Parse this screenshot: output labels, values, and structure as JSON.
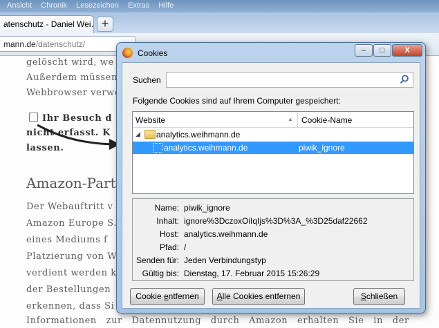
{
  "browser": {
    "menu": [
      "Ansicht",
      "Chronik",
      "Lesezeichen",
      "Extras",
      "Hilfe"
    ],
    "tab_title": "atenschutz - Daniel Wei…",
    "new_tab_label": "+",
    "url_domain": "mann.de",
    "url_path": "/datenschutz/"
  },
  "page": {
    "line1": "gelöscht wird, we",
    "line2": "Außerdem müssen",
    "line3": "Webbrowser verwe",
    "line4": "Ihr Besuch d",
    "line5": "nicht erfasst. K",
    "line6": "lassen.",
    "heading": "Amazon-Part",
    "para": [
      "Der Webauftritt v",
      "Amazon Europe S.",
      "eines Mediums f",
      "Platzierung von W",
      "verdient werden kö",
      "der Bestellungen",
      "erkennen, dass Si",
      "Informationen zur Datennutzung durch Amazon erhalten Sie in der"
    ]
  },
  "dialog": {
    "title": "Cookies",
    "search_label": "Suchen",
    "search_value": "",
    "info_text": "Folgende Cookies sind auf Ihrem Computer gespeichert:",
    "columns": [
      "Website",
      "Cookie-Name"
    ],
    "tree": {
      "group": "analytics.weihmann.de",
      "selected_site": "analytics.weihmann.de",
      "selected_name": "piwik_ignore"
    },
    "details": [
      {
        "label": "Name:",
        "value": "piwik_ignore"
      },
      {
        "label": "Inhalt:",
        "value": "ignore%3DczoxOiIqIjs%3D%3A_%3D25daf22662"
      },
      {
        "label": "Host:",
        "value": "analytics.weihmann.de"
      },
      {
        "label": "Pfad:",
        "value": "/"
      },
      {
        "label": "Senden für:",
        "value": "Jeden Verbindungstyp"
      },
      {
        "label": "Gültig bis:",
        "value": "Dienstag, 17. Februar 2015 15:26:29"
      }
    ],
    "buttons": {
      "remove_one_pre": "Cookie ",
      "remove_one_u": "e",
      "remove_one_post": "ntfernen",
      "remove_all_pre": "",
      "remove_all_u": "A",
      "remove_all_post": "lle Cookies entfernen",
      "close_pre": "",
      "close_u": "S",
      "close_post": "chließen"
    },
    "window_buttons": [
      "–",
      "□",
      "X"
    ]
  },
  "colors": {
    "selection": "#3399ff",
    "dialog_frame": "#a7c3e3",
    "titlebar_close": "#c0432b"
  }
}
